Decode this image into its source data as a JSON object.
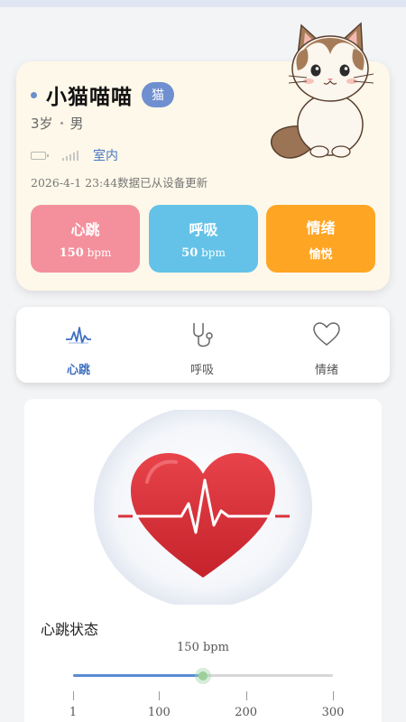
{
  "profile": {
    "name": "小猫喵喵",
    "species_badge": "猫",
    "age": "3岁",
    "gender": "男",
    "location": "室内",
    "update_text": "2026-4-1 23:44数据已从设备更新",
    "avatar_icon": "cat-illustration"
  },
  "metrics": [
    {
      "label": "心跳",
      "value": "150",
      "unit": " bpm",
      "color": "#f3909c"
    },
    {
      "label": "呼吸",
      "value": "50",
      "unit": " bpm",
      "color": "#64c2e8"
    },
    {
      "label": "情绪",
      "value": "愉悦",
      "unit": "",
      "color": "#ffa524"
    }
  ],
  "tabs": [
    {
      "label": "心跳",
      "icon": "heartbeat-wave-icon",
      "active": true
    },
    {
      "label": "呼吸",
      "icon": "stethoscope-icon",
      "active": false
    },
    {
      "label": "情绪",
      "icon": "heart-outline-icon",
      "active": false
    }
  ],
  "heart_panel": {
    "title": "心跳状态",
    "bpm_text": "150 bpm",
    "slider": {
      "value": 150,
      "min": 1,
      "max": 300
    },
    "tick_labels": [
      "1",
      "100",
      "200",
      "300"
    ],
    "tick_values": [
      1,
      100,
      200,
      300
    ]
  },
  "colors": {
    "accent": "#4a78c2",
    "card_bg": "#fdf8e9",
    "heart_red": "#d9323b"
  }
}
